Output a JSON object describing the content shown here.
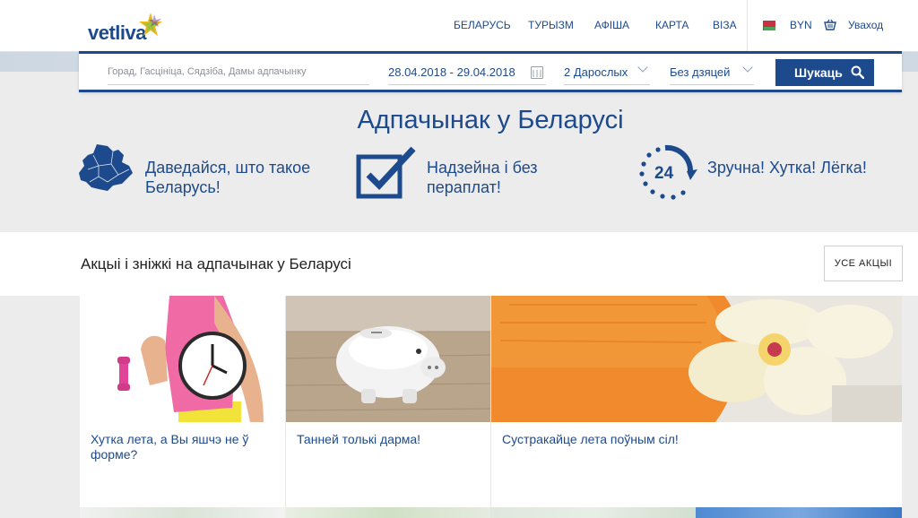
{
  "header": {
    "logo": "vetliva",
    "nav": [
      "БЕЛАРУСЬ",
      "ТУРЫЗМ",
      "АФІША",
      "КАРТА",
      "ВІЗА"
    ],
    "currency": "BYN",
    "login": "Уваход",
    "icons": [
      "belarus-flag-icon",
      "basket-icon"
    ]
  },
  "search": {
    "placeholder": "Горад, Гасцініца, Сядзіба, Дамы адпачынку",
    "dates": "28.04.2018 - 29.04.2018",
    "adults": "2 Дарослых",
    "children": "Без дзяцей",
    "button": "Шукаць"
  },
  "hero": {
    "title": "Адпачынак у Беларусі",
    "features": [
      {
        "icon": "belarus-map-icon",
        "text": "Даведайся, што такое Беларусь!"
      },
      {
        "icon": "checkmark-icon",
        "text": "Надзейна і без пераплат!"
      },
      {
        "icon": "24-hours-icon",
        "badge": "24",
        "text": "Зручна! Хутка! Лёгка!"
      }
    ]
  },
  "promotions": {
    "title": "Акцыі і зніжкі на адпачынак у Беларусі",
    "all_button": "УСЕ АКЦЫІ",
    "cards": [
      {
        "caption": "Хутка лета, а Вы яшчэ не ў форме?",
        "image": "woman-with-clock-and-dumbbells"
      },
      {
        "caption": "Танней толькі дарма!",
        "image": "piggy-bank"
      },
      {
        "caption": "Сустракайце лета поўным сіл!",
        "image": "orange-towel-and-orchid"
      }
    ]
  },
  "colors": {
    "brand": "#1d4a8c",
    "background": "#ececec"
  }
}
